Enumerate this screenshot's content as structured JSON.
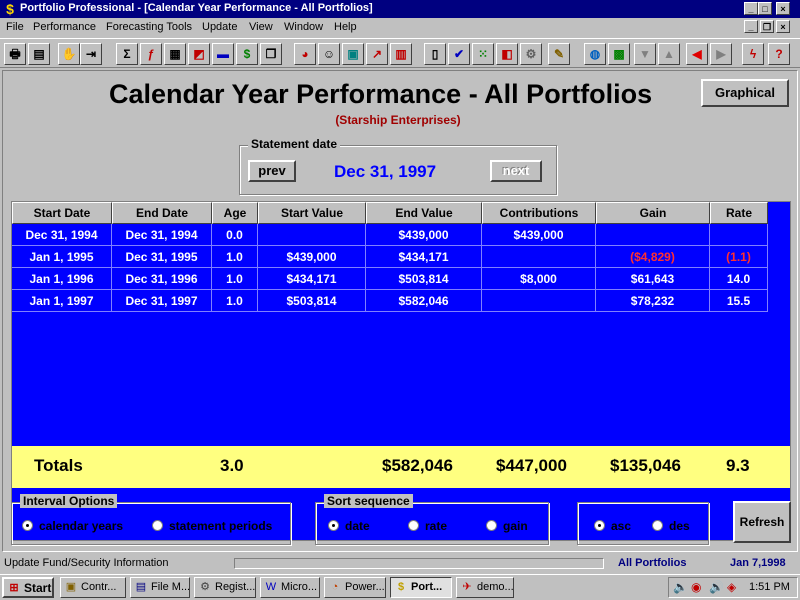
{
  "window": {
    "app_icon": "dollar-icon",
    "title": "Portfolio Professional - [Calendar Year Performance - All Portfolios]"
  },
  "menu": [
    "File",
    "Performance",
    "Forecasting Tools",
    "Update",
    "View",
    "Window",
    "Help"
  ],
  "toolbar": [
    {
      "icon": "print-icon",
      "glyph": "🖶",
      "color": "#000000"
    },
    {
      "icon": "preview-icon",
      "glyph": "▤",
      "color": "#000000"
    },
    {
      "icon": "hand-icon",
      "glyph": "✋",
      "color": "#c00000"
    },
    {
      "icon": "exit-door-icon",
      "glyph": "⇥",
      "color": "#000000"
    },
    {
      "icon": "sigma-icon",
      "glyph": "Σ",
      "color": "#000000"
    },
    {
      "icon": "function-icon",
      "glyph": "ƒ",
      "color": "#c00000"
    },
    {
      "icon": "calculator-icon",
      "glyph": "▦",
      "color": "#000000"
    },
    {
      "icon": "chart-mix-icon",
      "glyph": "◩",
      "color": "#c00000"
    },
    {
      "icon": "stacked-blocks-icon",
      "glyph": "▬",
      "color": "#0000c0"
    },
    {
      "icon": "money-bag-icon",
      "glyph": "$",
      "color": "#008000"
    },
    {
      "icon": "documents-icon",
      "glyph": "❐",
      "color": "#000000"
    },
    {
      "icon": "pie-chart-icon",
      "glyph": "◕",
      "color": "#c00000"
    },
    {
      "icon": "people-icon",
      "glyph": "☺",
      "color": "#000000"
    },
    {
      "icon": "calculator-green-icon",
      "glyph": "▣",
      "color": "#008080"
    },
    {
      "icon": "line-chart-icon",
      "glyph": "↗",
      "color": "#c00000"
    },
    {
      "icon": "bar-chart-icon",
      "glyph": "▥",
      "color": "#c00000"
    },
    {
      "icon": "book-icon",
      "glyph": "▯",
      "color": "#000000"
    },
    {
      "icon": "check-shield-icon",
      "glyph": "✔",
      "color": "#0000c0"
    },
    {
      "icon": "grid-dots-icon",
      "glyph": "⁙",
      "color": "#008000"
    },
    {
      "icon": "color-blocks-icon",
      "glyph": "◧",
      "color": "#c00000"
    },
    {
      "icon": "gear-icon",
      "glyph": "⚙",
      "color": "#606060"
    },
    {
      "icon": "pencil-icon",
      "glyph": "✎",
      "color": "#806000"
    },
    {
      "icon": "globe-icon",
      "glyph": "◍",
      "color": "#0060c0"
    },
    {
      "icon": "picture-icon",
      "glyph": "▩",
      "color": "#008000"
    },
    {
      "icon": "arrow-down-icon",
      "glyph": "▼",
      "color": "#808080"
    },
    {
      "icon": "arrow-up-icon",
      "glyph": "▲",
      "color": "#808080"
    },
    {
      "icon": "arrow-left-icon",
      "glyph": "◀",
      "color": "#e00000"
    },
    {
      "icon": "arrow-right-icon",
      "glyph": "▶",
      "color": "#808080"
    },
    {
      "icon": "lightning-icon",
      "glyph": "ϟ",
      "color": "#c00000"
    },
    {
      "icon": "help-icon",
      "glyph": "?",
      "color": "#c00000"
    }
  ],
  "report": {
    "title": "Calendar Year Performance - All Portfolios",
    "subtitle": "(Starship Enterprises)",
    "graphical_label": "Graphical",
    "statement_label": "Statement date",
    "prev_label": "prev",
    "next_label": "next",
    "statement_date": "Dec 31, 1997"
  },
  "table": {
    "headers": [
      "Start Date",
      "End Date",
      "Age",
      "Start Value",
      "End Value",
      "Contributions",
      "Gain",
      "Rate"
    ],
    "rows": [
      [
        "Dec 31, 1994",
        "Dec 31, 1994",
        "0.0",
        "",
        "$439,000",
        "$439,000",
        "",
        ""
      ],
      [
        "Jan 1, 1995",
        "Dec 31, 1995",
        "1.0",
        "$439,000",
        "$434,171",
        "",
        "($4,829)",
        "(1.1)"
      ],
      [
        "Jan 1, 1996",
        "Dec 31, 1996",
        "1.0",
        "$434,171",
        "$503,814",
        "$8,000",
        "$61,643",
        "14.0"
      ],
      [
        "Jan 1, 1997",
        "Dec 31, 1997",
        "1.0",
        "$503,814",
        "$582,046",
        "",
        "$78,232",
        "15.5"
      ]
    ],
    "totals": {
      "label": "Totals",
      "age": "3.0",
      "end_value": "$582,046",
      "contributions": "$447,000",
      "gain": "$135,046",
      "rate": "9.3"
    }
  },
  "interval": {
    "label": "Interval Options",
    "options": [
      "calendar years",
      "statement periods"
    ],
    "selected": "calendar years"
  },
  "sort": {
    "label": "Sort sequence",
    "options": [
      "date",
      "rate",
      "gain"
    ],
    "selected": "date"
  },
  "order": {
    "options": [
      "asc",
      "des"
    ],
    "selected": "asc"
  },
  "refresh_label": "Refresh",
  "status": {
    "message": "Update Fund/Security Information",
    "portfolio": "All Portfolios",
    "date": "Jan 7,1998"
  },
  "taskbar": {
    "start_label": "Start",
    "tasks": [
      {
        "label": "Contr...",
        "icon": "control-panel-icon"
      },
      {
        "label": "File M...",
        "icon": "file-manager-icon"
      },
      {
        "label": "Regist...",
        "icon": "registry-icon"
      },
      {
        "label": "Micro...",
        "icon": "word-icon"
      },
      {
        "label": "Power...",
        "icon": "powerpoint-icon"
      },
      {
        "label": "Port...",
        "icon": "dollar-icon",
        "active": true
      },
      {
        "label": "demo...",
        "icon": "demo-icon"
      }
    ],
    "clock": "1:51 PM"
  },
  "colors": {
    "grid_bg": "#0000ff",
    "totals_bg": "#ffff80",
    "negative": "#ff3030",
    "subtitle": "#a00000",
    "date_text": "#0000ff",
    "title_bar": "#000080"
  }
}
